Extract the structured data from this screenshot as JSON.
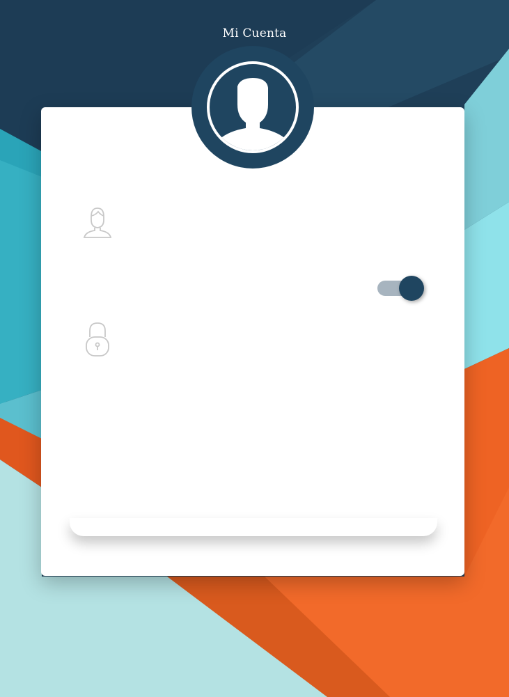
{
  "header": {
    "title": "Mi Cuenta"
  },
  "profile": {
    "avatar_icon": "user-silhouette-icon"
  },
  "form": {
    "username_icon": "user-outline-icon",
    "password_icon": "lock-icon",
    "toggle_on": true
  },
  "colors": {
    "navy": "#1f4560",
    "teal": "#3bb6c6",
    "light_teal": "#b4e2e3",
    "orange": "#ee6324",
    "toggle_track": "#a7b4bf"
  }
}
